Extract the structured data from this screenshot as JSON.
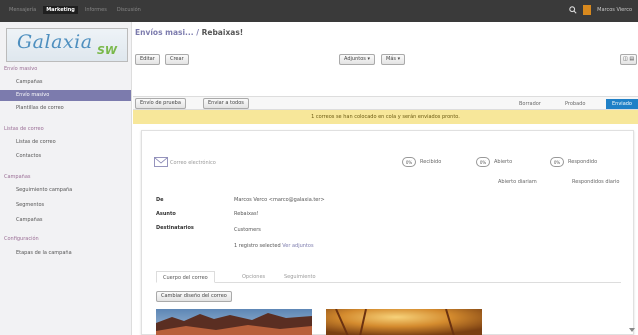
{
  "topbar": {
    "menu": [
      "Mensajería",
      "Marketing",
      "Informes",
      "Discusión"
    ],
    "active_index": 1,
    "username": "Marcos Vierco"
  },
  "sidebar": {
    "logo_text": "Galaxia",
    "logo_suffix": "SW",
    "sections": [
      {
        "title": "Envío masivo",
        "items": [
          "Campañas",
          "Envío masivo",
          "Plantillas de correo"
        ]
      },
      {
        "title": "Listas de correo",
        "items": [
          "Listas de correo",
          "Contactos"
        ]
      },
      {
        "title": "Campañas",
        "items": [
          "Seguimiento campaña",
          "Segmentos",
          "Campañas"
        ]
      },
      {
        "title": "Configuración",
        "items": [
          "Etapas de la campaña"
        ]
      }
    ],
    "active_item": "Envío masivo"
  },
  "header": {
    "breadcrumb_parent": "Envíos masi...",
    "breadcrumb_sep": " / ",
    "breadcrumb_current": "Rebaixas!",
    "buttons": {
      "edit": "Editar",
      "create": "Crear",
      "attachments": "Adjuntos ▾",
      "more": "Más ▾"
    },
    "pager": "◫ ▤",
    "action_buttons": {
      "test": "Envío de prueba",
      "send_all": "Enviar a todos"
    }
  },
  "status": {
    "stages": [
      "Borrador",
      "Probado",
      "Enviado"
    ],
    "active": "Enviado"
  },
  "alert": {
    "text": "1 correos se han colocado en cola y serán enviados pronto."
  },
  "sheet": {
    "title": "Correo electrónico",
    "stats": [
      {
        "value": "0%",
        "label": "Recibido"
      },
      {
        "value": "0%",
        "label": "Abierto"
      },
      {
        "value": "0%",
        "label": "Respondido"
      }
    ],
    "stat_subs": [
      "Abierto diariam",
      "Respondidos diario"
    ],
    "fields": [
      {
        "label": "De",
        "value": "Marcos Verco <marco@galaxia.ter>"
      },
      {
        "label": "Asunto",
        "value": "Rebaixas!"
      },
      {
        "label": "Destinatarios",
        "value": "Customers"
      }
    ],
    "selection": {
      "text": "1 registro selected",
      "link": "Ver adjuntos"
    },
    "tabs": [
      "Cuerpo del correo",
      "Opciones",
      "Seguimiento"
    ],
    "active_tab": 0,
    "change_design_button": "Cambiar diseño del correo"
  }
}
